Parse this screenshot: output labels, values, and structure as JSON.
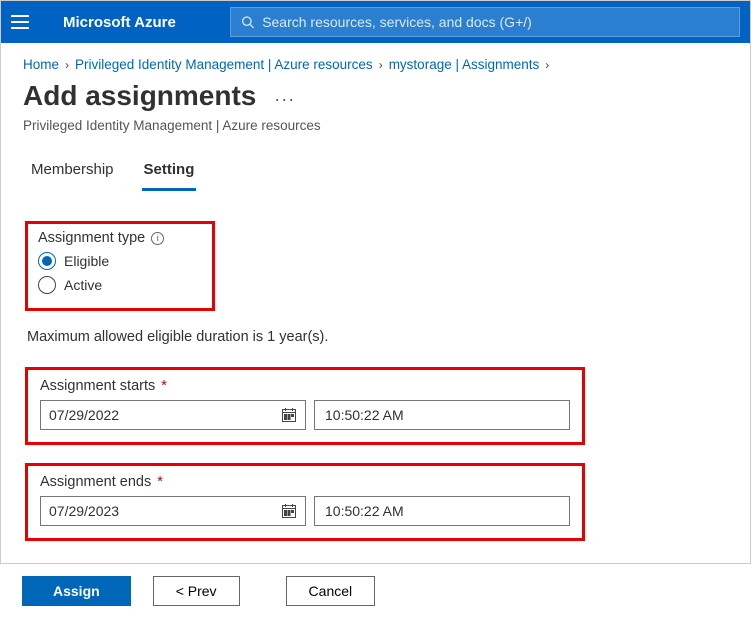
{
  "topbar": {
    "brand": "Microsoft Azure",
    "search_placeholder": "Search resources, services, and docs (G+/)"
  },
  "breadcrumbs": {
    "home": "Home",
    "pim": "Privileged Identity Management | Azure resources",
    "res": "mystorage | Assignments"
  },
  "page": {
    "title": "Add assignments",
    "subtitle": "Privileged Identity Management | Azure resources"
  },
  "tabs": {
    "membership": "Membership",
    "setting": "Setting"
  },
  "form": {
    "assignment_type_label": "Assignment type",
    "eligible": "Eligible",
    "active": "Active",
    "hint": "Maximum allowed eligible duration is 1 year(s).",
    "starts_label": "Assignment starts",
    "ends_label": "Assignment ends",
    "start_date": "07/29/2022",
    "start_time": "10:50:22 AM",
    "end_date": "07/29/2023",
    "end_time": "10:50:22 AM"
  },
  "footer": {
    "assign": "Assign",
    "prev": "<  Prev",
    "cancel": "Cancel"
  }
}
